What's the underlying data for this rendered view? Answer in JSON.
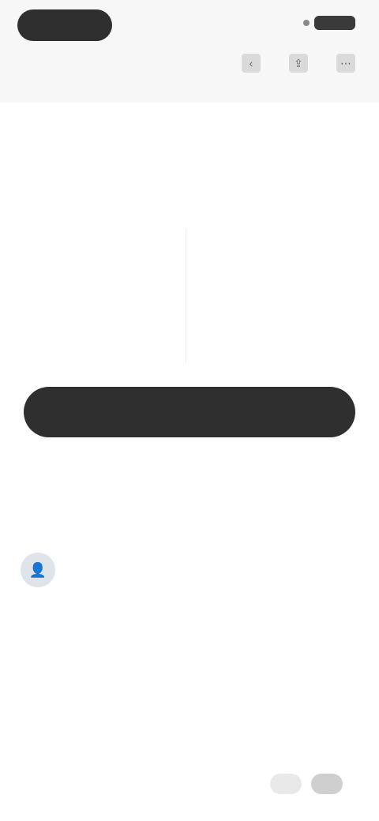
{
  "header": {
    "logo_label": "",
    "icons": [
      "back-icon",
      "share-icon",
      "more-icon"
    ]
  },
  "product": {
    "section_title": "",
    "price": ""
  },
  "info": {
    "left": {
      "label": "",
      "value": ""
    },
    "right": {
      "label": "",
      "values": [
        "",
        "",
        ""
      ]
    }
  },
  "cta": {
    "label": ""
  },
  "reviews": {
    "title": "",
    "item": {
      "name": "",
      "subtitle": "",
      "rating_strong": "",
      "date": "",
      "body": "",
      "body2": ""
    }
  },
  "pager": {
    "prev": "",
    "next": ""
  },
  "colors": {
    "primary": "#2f2f2f",
    "bg": "#ffffff",
    "muted": "#999999"
  }
}
